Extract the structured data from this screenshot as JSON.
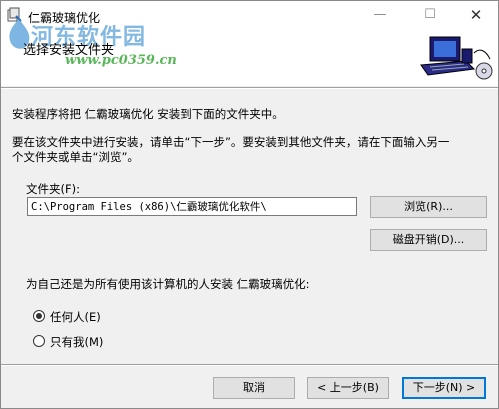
{
  "window": {
    "title": "仁霸玻璃优化",
    "controls": {
      "minimize": "—",
      "maximize": "☐",
      "close": "✕"
    }
  },
  "banner": {
    "heading": "选择安装文件夹",
    "watermark_title": "河东软件园",
    "watermark_url": "www.pc0359.cn"
  },
  "body": {
    "line1": "安装程序将把 仁霸玻璃优化 安装到下面的文件夹中。",
    "line2": "要在该文件夹中进行安装，请单击“下一步”。要安装到其他文件夹，请在下面输入另一",
    "line3": "个文件夹或单击“浏览”。",
    "folder_label": "文件夹(F):",
    "folder_value": "C:\\Program Files (x86)\\仁霸玻璃优化软件\\",
    "browse_label": "浏览(R)...",
    "disk_cost_label": "磁盘开销(D)...",
    "question": "为自己还是为所有使用该计算机的人安装 仁霸玻璃优化:",
    "options": [
      {
        "label": "任何人(E)",
        "selected": true
      },
      {
        "label": "只有我(M)",
        "selected": false
      }
    ]
  },
  "footer": {
    "cancel_label": "取消",
    "prev_label": "< 上一步(B)",
    "next_label": "下一步(N) >"
  }
}
